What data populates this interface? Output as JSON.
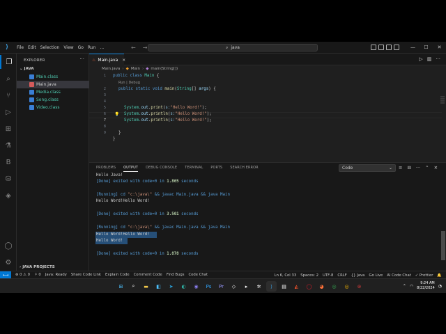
{
  "titlebar": {
    "menu": [
      "File",
      "Edit",
      "Selection",
      "View",
      "Go",
      "Run",
      "..."
    ],
    "search_text": "java",
    "controls": [
      "—",
      "☐",
      "✕"
    ]
  },
  "sidebar": {
    "title": "EXPLORER",
    "folder": "JAVA",
    "files": [
      "Main.class",
      "Main.java",
      "Media.class",
      "Song.class",
      "Video.class"
    ],
    "projects_label": "JAVA PROJECTS"
  },
  "editor": {
    "tab_label": "Main.java",
    "tab_close": "×",
    "breadcrumbs": [
      "Main.java",
      "Main",
      "main(String[])"
    ],
    "codelens": "Run | Debug",
    "line_numbers": [
      "1",
      "2",
      "3",
      "4",
      "5",
      "6",
      "7",
      "8",
      "9"
    ],
    "code": {
      "l1_kw1": "public",
      "l1_kw2": "class",
      "l1_cls": "Main",
      "l1_rest": " {",
      "l2_kw1": "public",
      "l2_kw2": "static",
      "l2_kw3": "void",
      "l2_fn": "main",
      "l2_p1": "(",
      "l2_type": "String",
      "l2_p2": "[] ",
      "l2_var": "args",
      "l2_p3": ") {",
      "print_obj": "System.",
      "print_out": "out",
      "l5_fn": "print",
      "l6_fn": "println",
      "l7_fn": "println",
      "param_label": "s:",
      "string_arg": "\"Hello Word!\"",
      "close_paren": ");",
      "l8": "}",
      "l9": "}"
    }
  },
  "panel": {
    "tabs": [
      "PROBLEMS",
      "OUTPUT",
      "DEBUG CONSOLE",
      "TERMINAL",
      "PORTS",
      "SEARCH ERROR"
    ],
    "active_tab": "OUTPUT",
    "channel": "Code",
    "output": {
      "o1": "Hello Java!",
      "done_prefix": "[Done] exited with code=0 in ",
      "done_suffix": " seconds",
      "t1": "1.865",
      "t2": "3.501",
      "t3": "1.878",
      "running_prefix": "[Running] cd ",
      "running_path": "\"c:\\java\\\"",
      "running_suffix": " && javac Main.java && java Main",
      "o2": "Hello Word!Hello Word!",
      "o3a": "Hello Word!Hello Word!",
      "o3b": "Hello Word!"
    }
  },
  "statusbar": {
    "errors": "⊗ 0 ⚠ 0",
    "ports": "⚐ 0",
    "java": "Java: Ready",
    "share": "Share Code Link",
    "explain": "Explain Code",
    "comment": "Comment Code",
    "bugs": "Find Bugs",
    "chat": "Code Chat",
    "position": "Ln 6, Col 33",
    "spaces": "Spaces: 2",
    "encoding": "UTF-8",
    "eol": "CRLF",
    "language": "{} Java",
    "golive": "Go Live",
    "aichat": "AI Code Chat",
    "prettier": "✓ Prettier"
  },
  "taskbar": {
    "time": "9:24 AM",
    "date": "8/22/2024"
  }
}
